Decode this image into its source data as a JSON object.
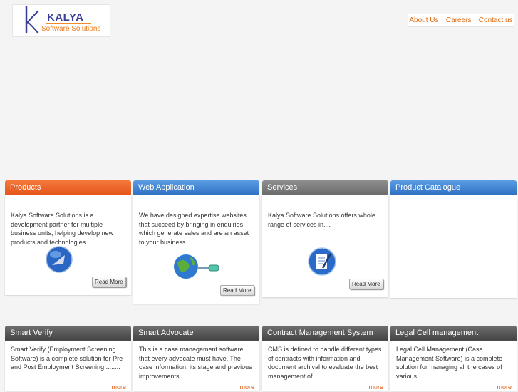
{
  "logo": {
    "name": "KALYA",
    "subtitle": "Software Solutions"
  },
  "topnav": {
    "about": "About Us",
    "careers": "Careers",
    "contact": "Contact us"
  },
  "panels": [
    {
      "title": "Products",
      "text": "Kalya Software Solutions is a development partner for multiple business units, helping develop new products and technologies....",
      "button": "Read More"
    },
    {
      "title": "Web Application",
      "text": "We have designed expertise websites that succeed by bringing in enquiries, which generate sales and are an asset to your business....",
      "button": "Read More"
    },
    {
      "title": "Services",
      "text": "Kalya Software Solutions offers whole range of services in....",
      "button": "Read More"
    },
    {
      "title": "Product Catalogue"
    }
  ],
  "products": [
    {
      "title": "Smart Verify",
      "text": "Smart Verify (Employment Screening Software) is a complete solution for Pre and Post Employment Screening ........",
      "more": "more"
    },
    {
      "title": "Smart Advocate",
      "text": "This is a case management software that every advocate must have. The case information, its stage and previous improvements ........",
      "more": "more"
    },
    {
      "title": "Contract Management System",
      "text": "CMS is defined to handle different types of contracts with information and document archival to evaluate the best management of ........",
      "more": "more"
    },
    {
      "title": "Legal Cell management",
      "text": "Legal Cell Management (Case Management Software) is a complete solution for managing all the cases of various ........",
      "more": "more"
    }
  ],
  "colors": {
    "orange": "#e4531a",
    "blue": "#2f6fc4",
    "link": "#e06a10"
  }
}
